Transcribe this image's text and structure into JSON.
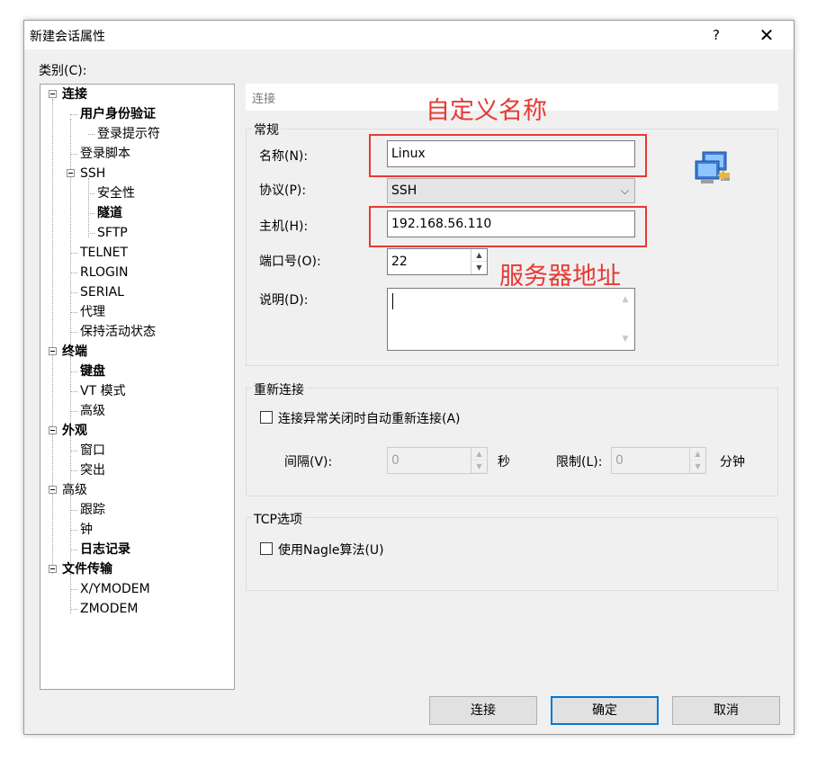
{
  "window": {
    "title": "新建会话属性",
    "help_label": "?",
    "close_label": "✕"
  },
  "category_label": "类别(C):",
  "tree": [
    {
      "label": "连接",
      "bold": true
    },
    {
      "label": "用户身份验证",
      "bold": true
    },
    {
      "label": "登录提示符",
      "bold": false
    },
    {
      "label": "登录脚本",
      "bold": false
    },
    {
      "label": "SSH",
      "bold": false
    },
    {
      "label": "安全性",
      "bold": false
    },
    {
      "label": "隧道",
      "bold": true
    },
    {
      "label": "SFTP",
      "bold": false
    },
    {
      "label": "TELNET",
      "bold": false
    },
    {
      "label": "RLOGIN",
      "bold": false
    },
    {
      "label": "SERIAL",
      "bold": false
    },
    {
      "label": "代理",
      "bold": false
    },
    {
      "label": "保持活动状态",
      "bold": false
    },
    {
      "label": "终端",
      "bold": true
    },
    {
      "label": "键盘",
      "bold": true
    },
    {
      "label": "VT 模式",
      "bold": false
    },
    {
      "label": "高级",
      "bold": false
    },
    {
      "label": "外观",
      "bold": true
    },
    {
      "label": "窗口",
      "bold": false
    },
    {
      "label": "突出",
      "bold": false
    },
    {
      "label": "高级",
      "bold": false
    },
    {
      "label": "跟踪",
      "bold": false
    },
    {
      "label": "钟",
      "bold": false
    },
    {
      "label": "日志记录",
      "bold": true
    },
    {
      "label": "文件传输",
      "bold": true
    },
    {
      "label": "X/YMODEM",
      "bold": false
    },
    {
      "label": "ZMODEM",
      "bold": false
    }
  ],
  "pane": {
    "header": "连接",
    "general": {
      "title": "常规",
      "name_label": "名称(N):",
      "name_value": "Linux",
      "protocol_label": "协议(P):",
      "protocol_value": "SSH",
      "host_label": "主机(H):",
      "host_value": "192.168.56.110",
      "port_label": "端口号(O):",
      "port_value": "22",
      "desc_label": "说明(D):",
      "desc_value": ""
    },
    "reconnect": {
      "title": "重新连接",
      "auto_label": "连接异常关闭时自动重新连接(A)",
      "auto_checked": false,
      "interval_label": "间隔(V):",
      "interval_value": "0",
      "interval_unit": "秒",
      "limit_label": "限制(L):",
      "limit_value": "0",
      "limit_unit": "分钟"
    },
    "tcp": {
      "title": "TCP选项",
      "nagle_label": "使用Nagle算法(U)",
      "nagle_checked": false
    }
  },
  "buttons": {
    "connect": "连接",
    "ok": "确定",
    "cancel": "取消"
  },
  "annotations": {
    "name_note": "自定义名称",
    "host_note": "服务器地址",
    "color": "#e53935"
  },
  "icons": {
    "session_icon": "network-computers-icon"
  }
}
